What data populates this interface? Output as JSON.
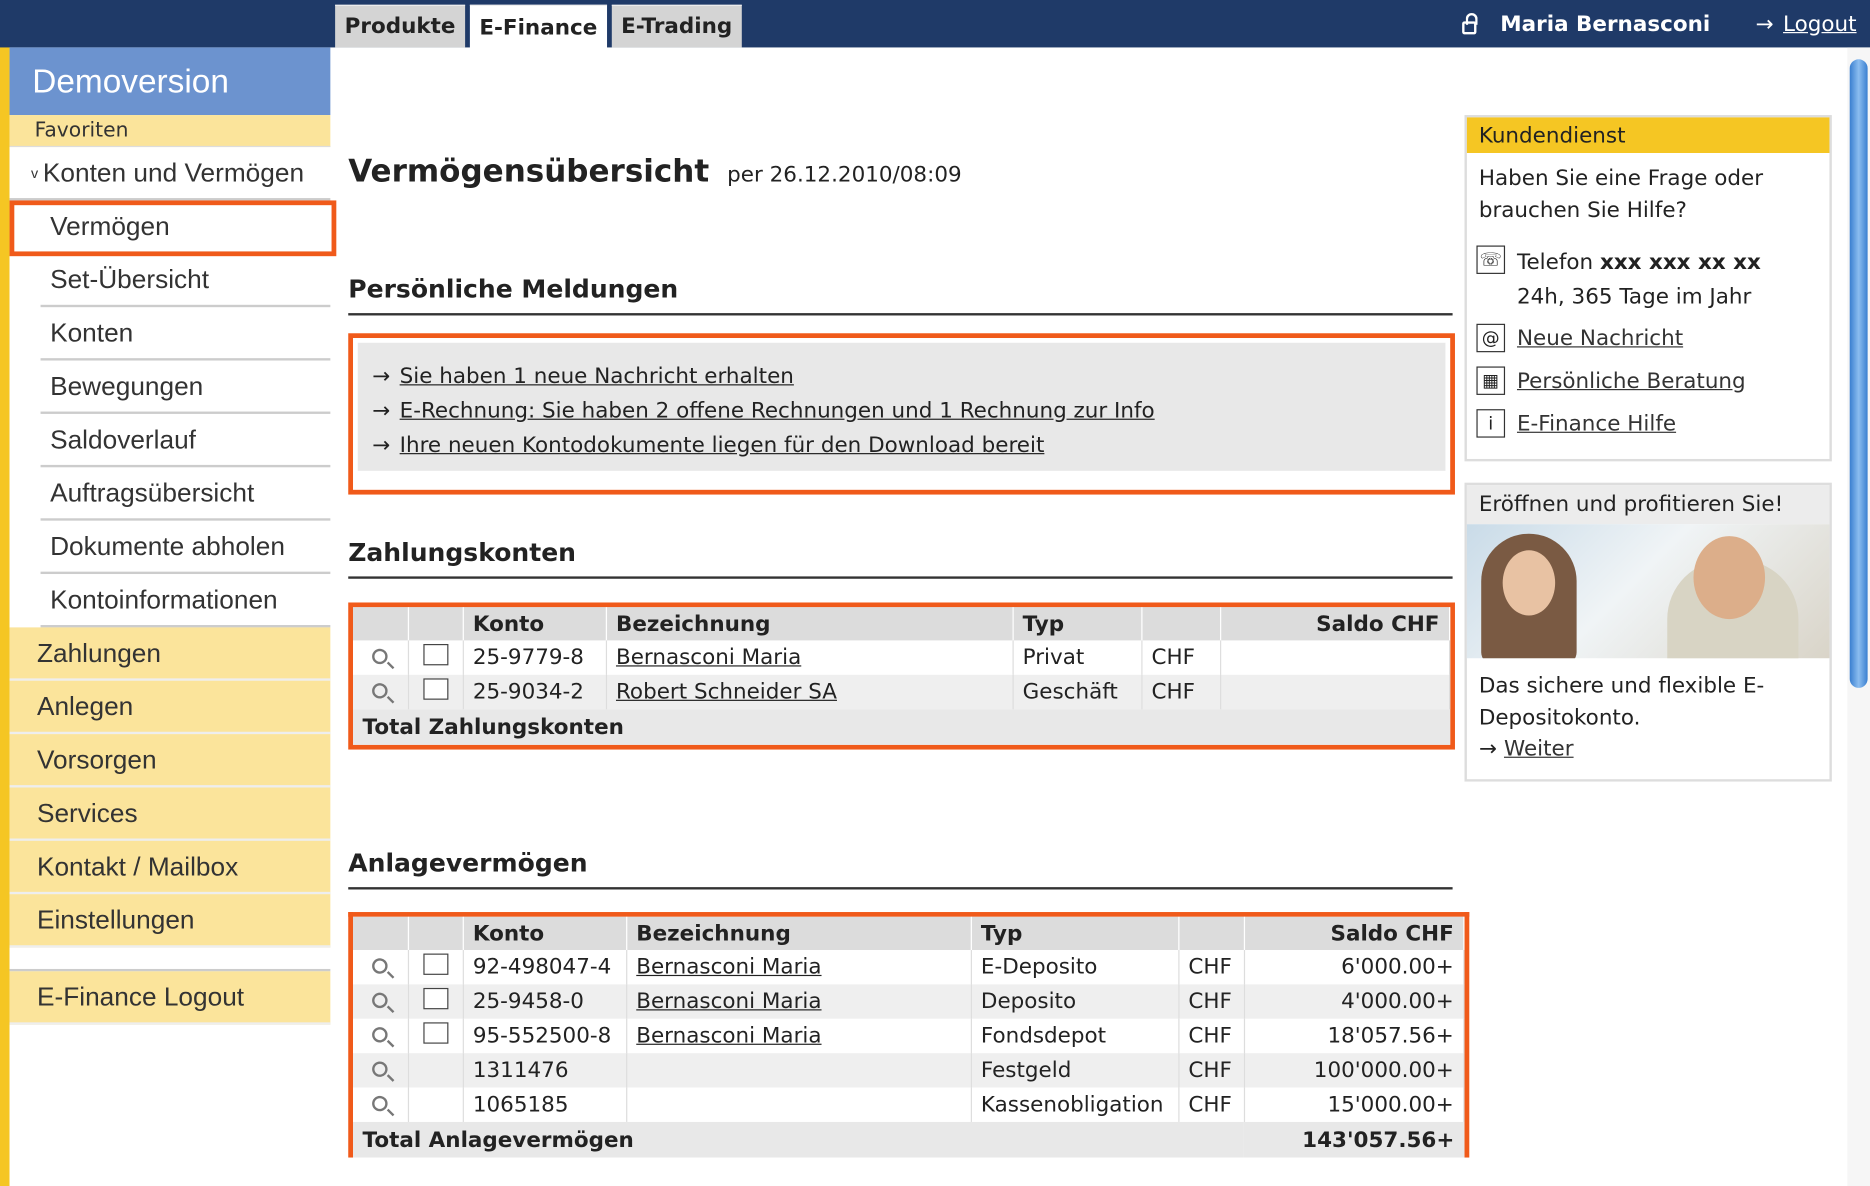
{
  "tabs": [
    "Produkte",
    "E-Finance",
    "E-Trading"
  ],
  "user": {
    "name": "Maria Bernasconi",
    "logout": "Logout",
    "arrow": "→"
  },
  "sidebar": {
    "title": "Demoversion",
    "favorites": "Favoriten",
    "section": "Konten und Vermögen",
    "chevron": "v",
    "sub_items": [
      "Vermögen",
      "Set-Übersicht",
      "Konten",
      "Bewegungen",
      "Saldoverlauf",
      "Auftragsübersicht",
      "Dokumente abholen",
      "Kontoinformationen"
    ],
    "main_items": [
      "Zahlungen",
      "Anlegen",
      "Vorsorgen",
      "Services",
      "Kontakt / Mailbox",
      "Einstellungen"
    ],
    "logout": "E-Finance Logout"
  },
  "main": {
    "title": "Vermögensübersicht",
    "subtitle": "per 26.12.2010/08:09",
    "messages_heading": "Persönliche Meldungen",
    "messages": [
      "Sie haben 1 neue Nachricht erhalten",
      "E-Rechnung: Sie haben 2 offene Rechnungen und 1 Rechnung zur Info",
      "Ihre neuen Kontodokumente liegen für den Download bereit"
    ],
    "arrow": "→",
    "payments": {
      "heading": "Zahlungskonten",
      "columns": [
        "Konto",
        "Bezeichnung",
        "Typ",
        "Saldo CHF"
      ],
      "rows": [
        {
          "konto": "25-9779-8",
          "bezeichnung": "Bernasconi Maria",
          "typ": "Privat",
          "currency": "CHF",
          "saldo": ""
        },
        {
          "konto": "25-9034-2",
          "bezeichnung": "Robert Schneider SA",
          "typ": "Geschäft",
          "currency": "CHF",
          "saldo": ""
        }
      ],
      "total_label": "Total Zahlungskonten",
      "total_value": ""
    },
    "assets": {
      "heading": "Anlagevermögen",
      "columns": [
        "Konto",
        "Bezeichnung",
        "Typ",
        "Saldo CHF"
      ],
      "rows": [
        {
          "konto": "92-498047-4",
          "bezeichnung": "Bernasconi Maria",
          "typ": "E-Deposito",
          "currency": "CHF",
          "saldo": "6'000.00+"
        },
        {
          "konto": "25-9458-0",
          "bezeichnung": "Bernasconi Maria",
          "typ": "Deposito",
          "currency": "CHF",
          "saldo": "4'000.00+"
        },
        {
          "konto": "95-552500-8",
          "bezeichnung": "Bernasconi Maria",
          "typ": "Fondsdepot",
          "currency": "CHF",
          "saldo": "18'057.56+"
        },
        {
          "konto": "1311476",
          "bezeichnung": "",
          "typ": "Festgeld",
          "currency": "CHF",
          "saldo": "100'000.00+"
        },
        {
          "konto": "1065185",
          "bezeichnung": "",
          "typ": "Kassenobligation",
          "currency": "CHF",
          "saldo": "15'000.00+"
        }
      ],
      "total_label": "Total Anlagevermögen",
      "total_value": "143'057.56+"
    }
  },
  "right": {
    "kd_title": "Kundendienst",
    "kd_text": "Haben Sie eine Frage oder brauchen Sie Hilfe?",
    "phone_label": "Telefon",
    "phone_number": "xxx xxx xx xx",
    "phone_hours": "24h, 365 Tage im Jahr",
    "links": [
      "Neue Nachricht",
      "Persönliche Beratung",
      "E-Finance Hilfe"
    ],
    "promo_title": "Eröffnen und profitieren Sie!",
    "promo_text": "Das sichere und flexible E-Depositokonto.",
    "promo_link": "Weiter"
  },
  "colors": {
    "navy": "#1f3a68",
    "yellow": "#f5c623",
    "light_yellow": "#fbe49b",
    "blue": "#6c93cf",
    "highlight": "#f05a1a"
  }
}
